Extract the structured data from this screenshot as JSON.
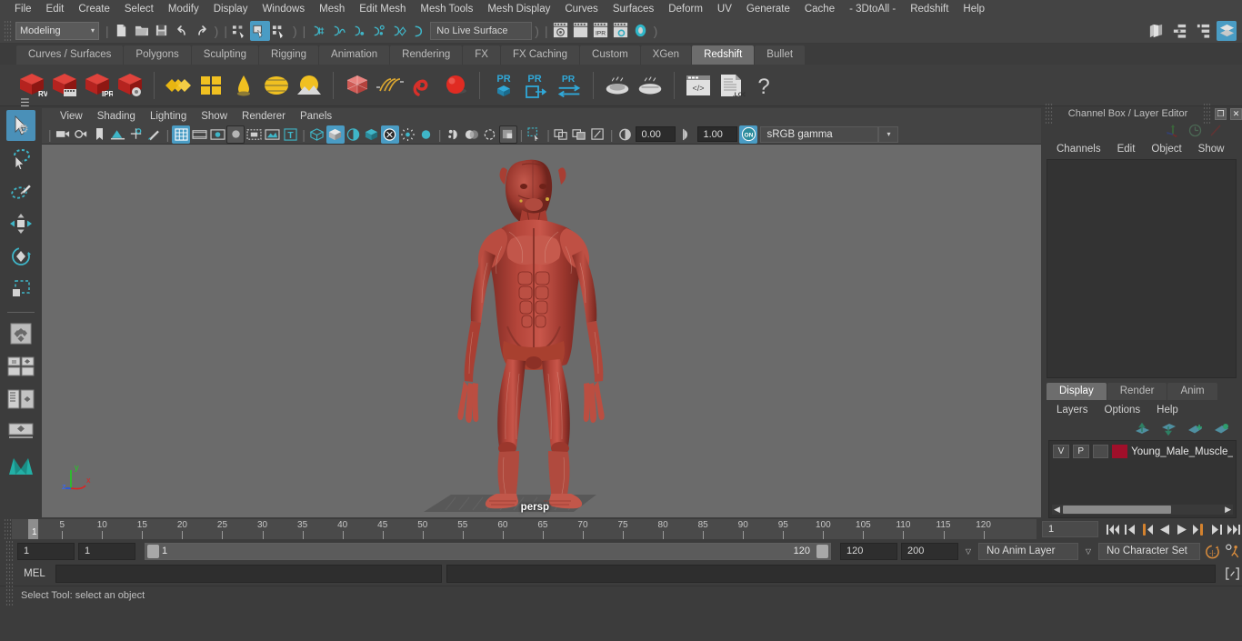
{
  "menubar": {
    "items": [
      "File",
      "Edit",
      "Create",
      "Select",
      "Modify",
      "Display",
      "Windows",
      "Mesh",
      "Edit Mesh",
      "Mesh Tools",
      "Mesh Display",
      "Curves",
      "Surfaces",
      "Deform",
      "UV",
      "Generate",
      "Cache",
      "- 3DtoAll -",
      "Redshift",
      "Help"
    ]
  },
  "statusline": {
    "mode": "Modeling",
    "mode_arrow": "▾",
    "live_surface": "No Live Surface",
    "icons": [
      "select-by-hierarchy-icon",
      "select-by-object-icon",
      "select-by-component-icon",
      "snap-to-grid-icon",
      "snap-to-curve-icon",
      "snap-to-point-icon",
      "snap-to-projected-center-icon",
      "snap-to-view-plane-icon",
      "make-live-icon",
      "render-view-icon",
      "render-sequence-icon",
      "ipr-render-icon",
      "render-settings-icon",
      "toggle-history-icon",
      "outliner-icon",
      "attribute-editor-icon",
      "channel-box-icon",
      "layer-editor-icon"
    ]
  },
  "shelf": {
    "tabs": [
      "Curves / Surfaces",
      "Polygons",
      "Sculpting",
      "Rigging",
      "Animation",
      "Rendering",
      "FX",
      "FX Caching",
      "Custom",
      "XGen",
      "Redshift",
      "Bullet"
    ],
    "active_tab": "Redshift",
    "buttons": [
      {
        "name": "redshift-render-view",
        "label": "RV"
      },
      {
        "name": "redshift-render-sequence",
        "label": ""
      },
      {
        "name": "redshift-ipr",
        "label": "IPR"
      },
      {
        "name": "redshift-render-settings",
        "label": ""
      },
      {
        "name": "redshift-material",
        "label": ""
      },
      {
        "name": "redshift-proxy",
        "label": ""
      },
      {
        "name": "redshift-light-dome",
        "label": ""
      },
      {
        "name": "redshift-env",
        "label": ""
      },
      {
        "name": "redshift-sun-sky",
        "label": ""
      },
      {
        "name": "redshift-bokeh",
        "label": ""
      },
      {
        "name": "redshift-hair",
        "label": ""
      },
      {
        "name": "redshift-volume",
        "label": ""
      },
      {
        "name": "redshift-sphere",
        "label": ""
      },
      {
        "name": "redshift-pr-proxy",
        "label": "PR"
      },
      {
        "name": "redshift-pr-export",
        "label": "PR"
      },
      {
        "name": "redshift-pr-transfer",
        "label": "PR"
      },
      {
        "name": "redshift-bake-1",
        "label": ""
      },
      {
        "name": "redshift-bake-2",
        "label": ""
      },
      {
        "name": "redshift-script-editor",
        "label": ""
      },
      {
        "name": "redshift-log",
        "label": ".LOG"
      },
      {
        "name": "redshift-help",
        "label": "?"
      }
    ]
  },
  "toolbox": {
    "items": [
      {
        "name": "select-tool",
        "selected": true
      },
      {
        "name": "lasso-select-tool",
        "selected": false
      },
      {
        "name": "paint-select-tool",
        "selected": false
      },
      {
        "name": "move-tool",
        "selected": false
      },
      {
        "name": "rotate-tool",
        "selected": false
      },
      {
        "name": "scale-tool",
        "selected": false
      },
      {
        "name": "last-tool-used",
        "selected": false
      },
      {
        "name": "single-perspective-view",
        "selected": false
      },
      {
        "name": "four-view-layout",
        "selected": false
      },
      {
        "name": "persp-outliner-layout",
        "selected": false
      },
      {
        "name": "persp-graph-layout",
        "selected": false
      },
      {
        "name": "maya-logo",
        "selected": false
      }
    ]
  },
  "viewport": {
    "menus": [
      "View",
      "Shading",
      "Lighting",
      "Show",
      "Renderer",
      "Panels"
    ],
    "camera_label": "persp",
    "exposure": "0.00",
    "gamma": "1.00",
    "color_management": "sRGB gamma",
    "gamma_arrow": "▾",
    "axis_labels": {
      "x": "x",
      "y": "y",
      "z": "z"
    },
    "toolbar_icons": [
      "select-camera-icon",
      "camera-attributes-icon",
      "bookmarks-icon",
      "image-plane-icon",
      "2d-pan-zoom-icon",
      "grease-pencil-icon",
      "grid-toggle-icon",
      "film-gate-icon",
      "resolution-gate-icon",
      "gate-mask-icon",
      "film-origin-icon",
      "safe-action-icon",
      "texture-text-icon",
      "wireframe-icon",
      "smooth-shade-icon",
      "shaded-wireframe-icon",
      "hardware-texturing-icon",
      "use-all-lights-icon",
      "shadows-icon",
      "ambient-occlusion-icon",
      "motion-blur-icon",
      "multisample-icon",
      "isolate-select-icon",
      "xray-icon",
      "xray-joints-icon",
      "xray-active-components-icon",
      "exposure-icon",
      "gamma-icon",
      "color-management-icon"
    ]
  },
  "right_panel": {
    "title": "Channel Box / Layer Editor",
    "undock_glyph": "❐",
    "close_glyph": "✕",
    "header_icons": [
      "transform-axis-icon",
      "clock-icon",
      "slash-icon"
    ],
    "menus": [
      "Channels",
      "Edit",
      "Object",
      "Show"
    ],
    "layer_tabs": [
      "Display",
      "Render",
      "Anim"
    ],
    "active_layer_tab": "Display",
    "layer_menus": [
      "Layers",
      "Options",
      "Help"
    ],
    "layer_icons": [
      "move-layer-up-icon",
      "move-layer-down-icon",
      "create-new-layer-icon",
      "create-layer-from-selected-icon"
    ],
    "layers": [
      {
        "visibility": "V",
        "playback": "P",
        "shading": "",
        "color": "#a00f2a",
        "name": "Young_Male_Muscle_S"
      }
    ]
  },
  "timeline": {
    "ticks": [
      5,
      10,
      15,
      20,
      25,
      30,
      35,
      40,
      45,
      50,
      55,
      60,
      65,
      70,
      75,
      80,
      85,
      90,
      95,
      100,
      105,
      110,
      115,
      120
    ],
    "current_frame_marker": "1",
    "current_frame_field": "1",
    "playback_buttons": [
      "go-to-start-icon",
      "step-back-frame-icon",
      "step-back-key-icon",
      "play-backwards-icon",
      "play-forwards-icon",
      "step-forward-key-icon",
      "step-forward-frame-icon",
      "go-to-end-icon"
    ]
  },
  "range": {
    "start_field": "1",
    "end_field": "1",
    "slider_start": "1",
    "slider_end": "120",
    "playback_start": "120",
    "playback_end": "200",
    "anim_layer": "No Anim Layer",
    "character_set": "No Character Set",
    "anim_arrow": "▽",
    "char_arrow": "▽",
    "right_icons": [
      "auto-keyframe-icon",
      "animation-preferences-icon"
    ]
  },
  "command_line": {
    "language": "MEL",
    "input_value": "",
    "output_value": "",
    "script_editor_icon": "script-editor-icon"
  },
  "help_line": {
    "text": "Select Tool: select an object"
  },
  "colors": {
    "accent": "#4a9cc4",
    "shelf_active": "#6d6d6d",
    "layer_red": "#a00f2a",
    "orange": "#d17c2b",
    "viewport_bg": "#6b6b6b"
  }
}
